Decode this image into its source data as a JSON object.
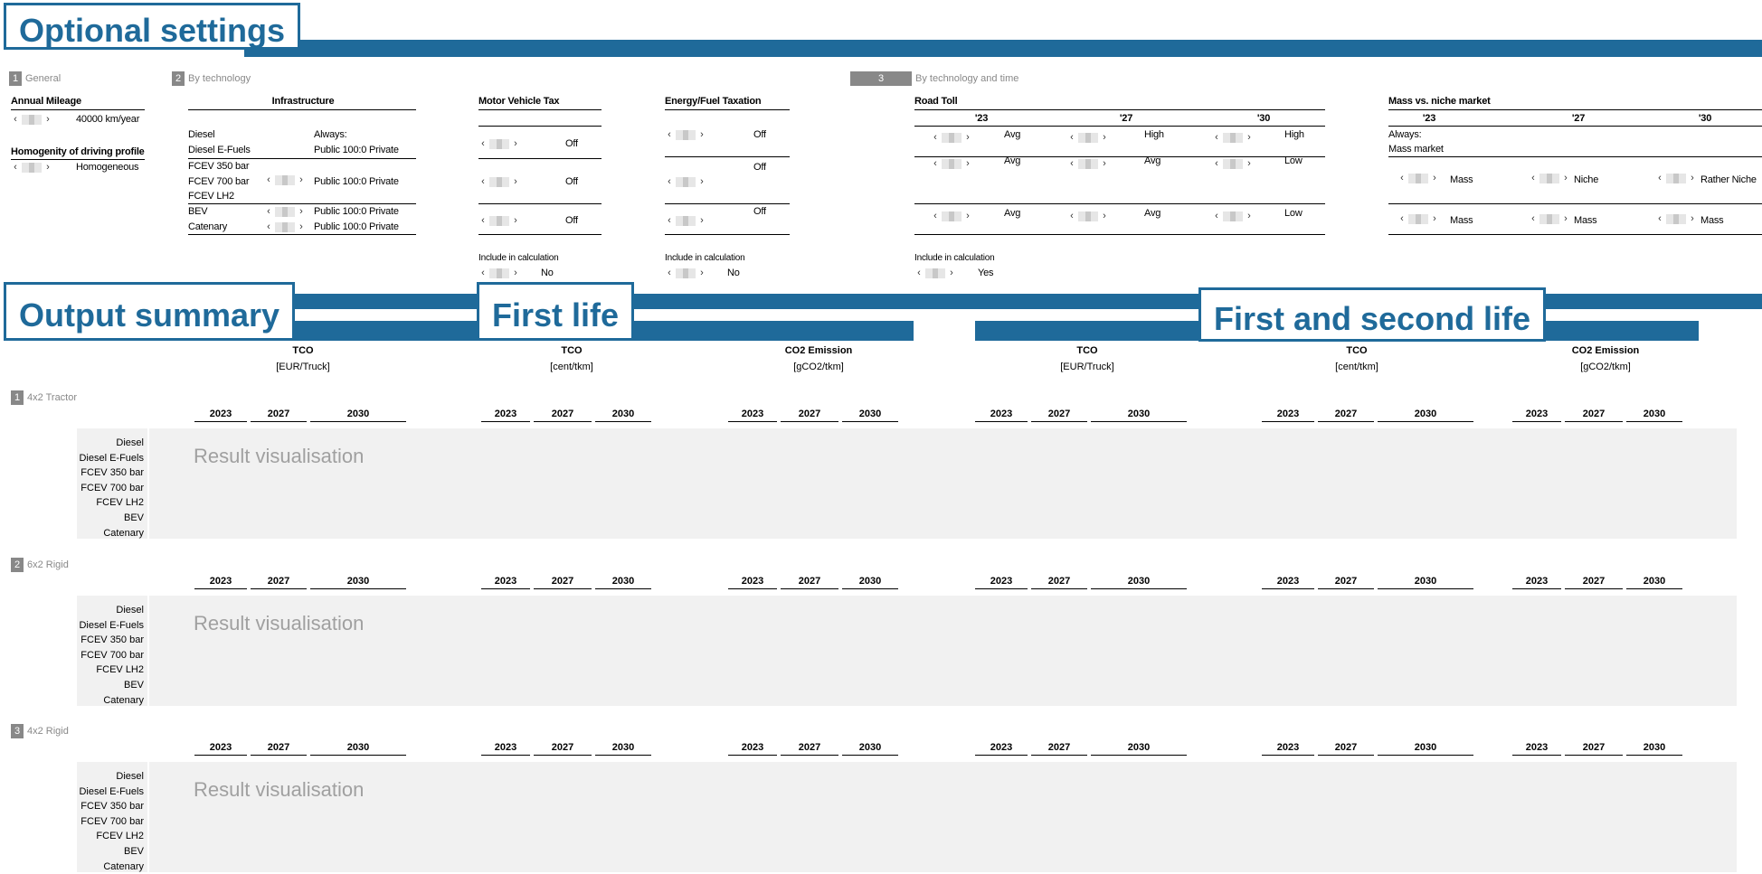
{
  "titles": {
    "optional_settings": "Optional settings",
    "output_summary": "Output summary",
    "first_life": "First life",
    "first_second_life": "First and second life"
  },
  "sections": {
    "general": {
      "num": "1",
      "label": "General"
    },
    "by_technology": {
      "num": "2",
      "label": "By technology"
    },
    "by_tech_time": {
      "num": "3",
      "label": "By technology and time"
    }
  },
  "general": {
    "annual_mileage_label": "Annual Mileage",
    "annual_mileage_value": "40000 km/year",
    "homogenity_label": "Homogenity of driving profile",
    "homogenity_value": "Homogeneous"
  },
  "infrastructure": {
    "header": "Infrastructure",
    "always": "Always:",
    "rows": [
      {
        "tech": "Diesel",
        "value": ""
      },
      {
        "tech": "Diesel E-Fuels",
        "value": "Public 100:0 Private"
      },
      {
        "tech": "FCEV 350 bar",
        "value": ""
      },
      {
        "tech": "FCEV 700 bar",
        "value": "Public 100:0 Private"
      },
      {
        "tech": "FCEV LH2",
        "value": ""
      },
      {
        "tech": "BEV",
        "value": "Public 100:0 Private"
      },
      {
        "tech": "Catenary",
        "value": "Public 100:0 Private"
      }
    ]
  },
  "motor_vehicle_tax": {
    "header": "Motor Vehicle Tax",
    "values": [
      "Off",
      "Off",
      "Off"
    ],
    "include_label": "Include in calculation",
    "include_value": "No"
  },
  "energy_tax": {
    "header": "Energy/Fuel Taxation",
    "values": [
      "Off",
      "Off",
      "Off"
    ],
    "include_label": "Include in calculation",
    "include_value": "No"
  },
  "road_toll": {
    "header": "Road Toll",
    "years": [
      "'23",
      "'27",
      "'30"
    ],
    "rows": [
      [
        "Avg",
        "High",
        "High"
      ],
      [
        "Avg",
        "Avg",
        "Low"
      ],
      [
        "Avg",
        "Avg",
        "Low"
      ]
    ],
    "include_label": "Include in calculation",
    "include_value": "Yes"
  },
  "mass_niche": {
    "header": "Mass vs. niche market",
    "years": [
      "'23",
      "'27",
      "'30"
    ],
    "always": "Always:",
    "always_value": "Mass market",
    "rows": [
      [
        "Mass",
        "Niche",
        "Rather Niche"
      ],
      [
        "Mass",
        "Mass",
        "Mass"
      ]
    ]
  },
  "metric_groups": [
    {
      "title": "TCO",
      "unit": "[EUR/Truck]"
    },
    {
      "title": "TCO",
      "unit": "[cent/tkm]"
    },
    {
      "title": "CO2 Emission",
      "unit": "[gCO2/tkm]"
    },
    {
      "title": "TCO",
      "unit": "[EUR/Truck]"
    },
    {
      "title": "TCO",
      "unit": "[cent/tkm]"
    },
    {
      "title": "CO2 Emission",
      "unit": "[gCO2/tkm]"
    }
  ],
  "years": [
    "2023",
    "2027",
    "2030"
  ],
  "vehicles": [
    {
      "num": "1",
      "label": "4x2 Tractor"
    },
    {
      "num": "2",
      "label": "6x2 Rigid"
    },
    {
      "num": "3",
      "label": "4x2 Rigid"
    }
  ],
  "technologies": [
    "Diesel",
    "Diesel E-Fuels",
    "FCEV 350 bar",
    "FCEV 700 bar",
    "FCEV LH2",
    "BEV",
    "Catenary"
  ],
  "result_placeholder": "Result visualisation",
  "colors": {
    "accent": "#1f6a9a",
    "panel": "#f1f1f1",
    "muted": "#888888"
  }
}
